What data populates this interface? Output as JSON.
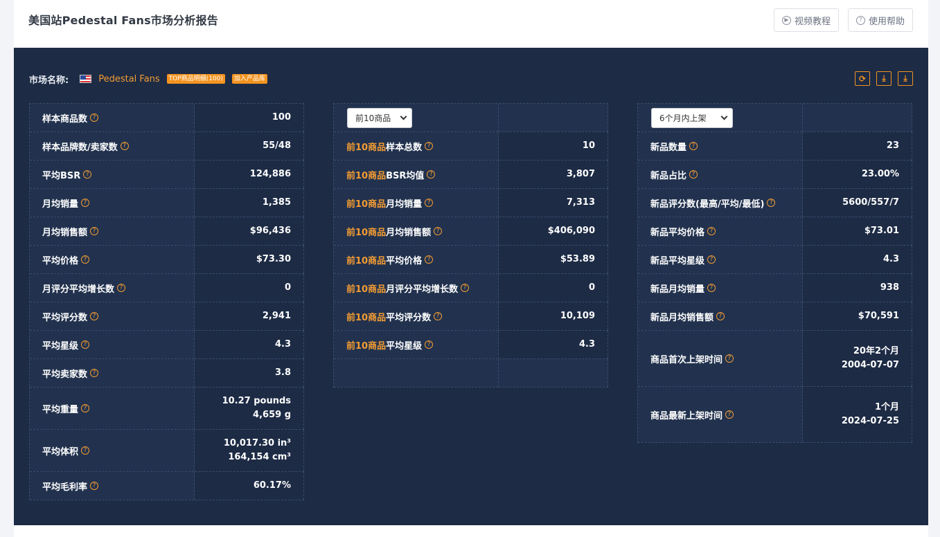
{
  "header": {
    "title": "美国站Pedestal Fans市场分析报告",
    "video_btn": "视频教程",
    "help_btn": "使用帮助"
  },
  "market": {
    "label": "市场名称:",
    "name": "Pedestal Fans",
    "tag_top": "TOP商品明细(100)",
    "tag_add": "加入产品库"
  },
  "col1": {
    "rows": [
      {
        "label": "样本商品数",
        "value": "100"
      },
      {
        "label": "样本品牌数/卖家数",
        "value": "55/48"
      },
      {
        "label": "平均BSR",
        "value": "124,886"
      },
      {
        "label": "月均销量",
        "value": "1,385"
      },
      {
        "label": "月均销售额",
        "value": "$96,436"
      },
      {
        "label": "平均价格",
        "value": "$73.30"
      },
      {
        "label": "月评分平均增长数",
        "value": "0"
      },
      {
        "label": "平均评分数",
        "value": "2,941"
      },
      {
        "label": "平均星级",
        "value": "4.3"
      },
      {
        "label": "平均卖家数",
        "value": "3.8"
      },
      {
        "label": "平均重量",
        "value": "10.27 pounds",
        "value2": "4,659 g"
      },
      {
        "label": "平均体积",
        "value": "10,017.30 in³",
        "value2": "164,154 cm³"
      },
      {
        "label": "平均毛利率",
        "value": "60.17%"
      }
    ]
  },
  "col2": {
    "select": "前10商品",
    "prefix": "前10商品",
    "rows": [
      {
        "label": "样本总数",
        "value": "10"
      },
      {
        "label": "BSR均值",
        "value": "3,807"
      },
      {
        "label": "月均销量",
        "value": "7,313"
      },
      {
        "label": "月均销售额",
        "value": "$406,090"
      },
      {
        "label": "平均价格",
        "value": "$53.89"
      },
      {
        "label": "月评分平均增长数",
        "value": "0"
      },
      {
        "label": "平均评分数",
        "value": "10,109"
      },
      {
        "label": "平均星级",
        "value": "4.3"
      }
    ]
  },
  "col3": {
    "select": "6个月内上架",
    "rows": [
      {
        "label": "新品数量",
        "value": "23"
      },
      {
        "label": "新品占比",
        "value": "23.00%"
      },
      {
        "label": "新品评分数(最高/平均/最低)",
        "value": "5600/557/7"
      },
      {
        "label": "新品平均价格",
        "value": "$73.01"
      },
      {
        "label": "新品平均星级",
        "value": "4.3"
      },
      {
        "label": "新品月均销量",
        "value": "938"
      },
      {
        "label": "新品月均销售额",
        "value": "$70,591"
      },
      {
        "label": "商品首次上架时间",
        "value": "20年2个月",
        "value2": "2004-07-07"
      },
      {
        "label": "商品最新上架时间",
        "value": "1个月",
        "value2": "2024-07-25"
      }
    ]
  },
  "help_glyph": "?"
}
